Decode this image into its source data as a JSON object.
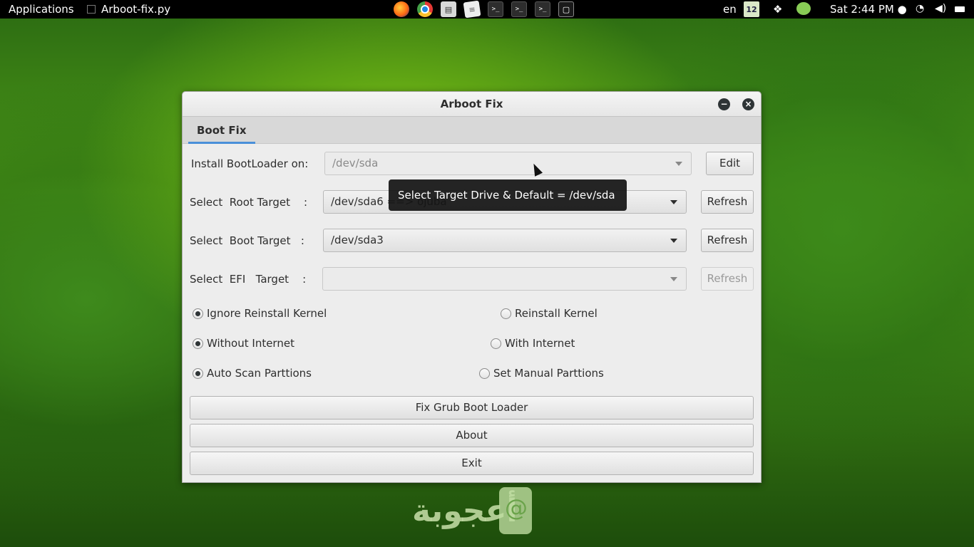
{
  "top_panel": {
    "applications": "Applications",
    "window_title": "Arboot-fix.py",
    "launchers": [
      "firefox-icon",
      "chrome-icon",
      "files-icon",
      "text-editor-icon",
      "terminal-icon",
      "terminal-icon",
      "terminal-icon",
      "window-icon"
    ],
    "lang": "en",
    "calendar_day": "12",
    "clock": "Sat  2:44 PM ●"
  },
  "window": {
    "title": "Arboot Fix",
    "tab": "Boot Fix",
    "install_label": "Install BootLoader on:",
    "install_value": "/dev/sda",
    "edit_button": "Edit",
    "root_label": "Select  Root Target    :",
    "root_value": "/dev/sda6 ==> ojuba",
    "boot_label": "Select  Boot Target   :",
    "boot_value": "/dev/sda3",
    "efi_label": "Select  EFI   Target    :",
    "efi_value": "",
    "refresh_button": "Refresh",
    "options": {
      "ignore_kernel": "Ignore Reinstall Kernel",
      "reinstall_kernel": "Reinstall Kernel",
      "without_internet": "Without Internet",
      "with_internet": "With Internet",
      "auto_scan": "Auto Scan Parttions",
      "manual": "Set Manual Parttions"
    },
    "fix_button": "Fix Grub Boot Loader",
    "about_button": "About",
    "exit_button": "Exit"
  },
  "tooltip": "Select Target Drive & Default = /dev/sda",
  "wallpaper_logo": "أعجوبة",
  "colors": {
    "accent": "#4a90d9",
    "panel": "#000000",
    "window_bg": "#ededed"
  }
}
